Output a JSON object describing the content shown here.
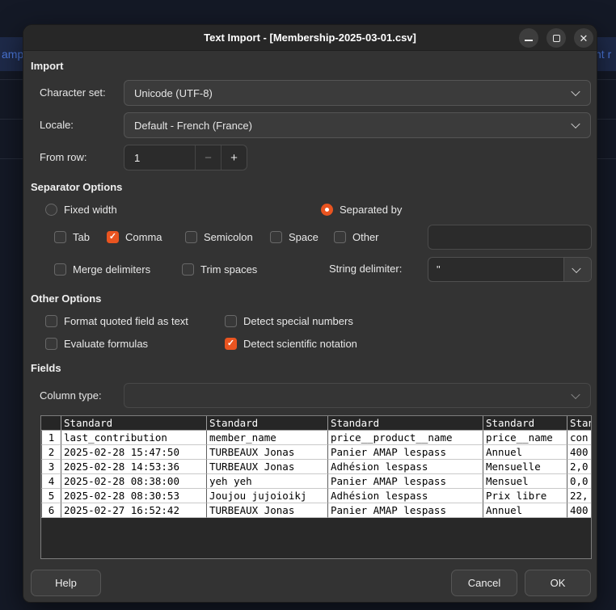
{
  "window": {
    "title": "Text Import - [Membership-2025-03-01.csv]"
  },
  "backdrop": {
    "left_fragment": "amp",
    "right_fragment": "nt r"
  },
  "import_section": {
    "heading": "Import",
    "character_set": {
      "label": "Character set:",
      "value": "Unicode (UTF-8)"
    },
    "locale": {
      "label": "Locale:",
      "value": "Default - French (France)"
    },
    "from_row": {
      "label": "From row:",
      "value": "1",
      "decrement": "−",
      "increment": "+"
    }
  },
  "separator_options": {
    "heading": "Separator Options",
    "fixed_width": {
      "label": "Fixed width",
      "checked": false
    },
    "separated_by": {
      "label": "Separated by",
      "checked": true
    },
    "tab": {
      "label": "Tab",
      "checked": false
    },
    "comma": {
      "label": "Comma",
      "checked": true
    },
    "semicolon": {
      "label": "Semicolon",
      "checked": false
    },
    "space": {
      "label": "Space",
      "checked": false
    },
    "other": {
      "label": "Other",
      "checked": false,
      "value": ""
    },
    "merge_delimiters": {
      "label": "Merge delimiters",
      "checked": false
    },
    "trim_spaces": {
      "label": "Trim spaces",
      "checked": false
    },
    "string_delimiter": {
      "label": "String delimiter:",
      "value": "\""
    }
  },
  "other_options": {
    "heading": "Other Options",
    "format_quoted": {
      "label": "Format quoted field as text",
      "checked": false
    },
    "detect_special": {
      "label": "Detect special numbers",
      "checked": false
    },
    "evaluate_formulas": {
      "label": "Evaluate formulas",
      "checked": false
    },
    "detect_scientific": {
      "label": "Detect scientific notation",
      "checked": true
    }
  },
  "fields_section": {
    "heading": "Fields",
    "column_type": {
      "label": "Column type:",
      "value": ""
    },
    "table": {
      "column_types": [
        "Standard",
        "Standard",
        "Standard",
        "Standard",
        "Standard"
      ],
      "row_numbers": [
        "1",
        "2",
        "3",
        "4",
        "5",
        "6"
      ],
      "rows": [
        [
          "last_contribution",
          "member_name",
          "price__product__name",
          "price__name",
          "con"
        ],
        [
          "2025-02-28 15:47:50",
          "TURBEAUX Jonas",
          "Panier AMAP lespass",
          "Annuel",
          "400"
        ],
        [
          "2025-02-28 14:53:36",
          "TURBEAUX Jonas",
          "Adhésion lespass",
          "Mensuelle",
          "2,0"
        ],
        [
          "2025-02-28 08:38:00",
          "yeh yeh",
          "Panier AMAP lespass",
          "Mensuel",
          "0,0"
        ],
        [
          "2025-02-28 08:30:53",
          "Joujou jujoioikj",
          "Adhésion lespass",
          "Prix libre",
          "22,"
        ],
        [
          "2025-02-27 16:52:42",
          "TURBEAUX Jonas",
          "Panier AMAP lespass",
          "Annuel",
          "400"
        ]
      ]
    }
  },
  "buttons": {
    "help": "Help",
    "cancel": "Cancel",
    "ok": "OK"
  },
  "icons": {
    "check": "✓",
    "minimize": "minus",
    "maximize": "square",
    "close": "✕"
  },
  "colors": {
    "accent": "#E95420",
    "dialog_bg": "#333333",
    "titlebar_bg": "#272727",
    "backdrop_bg": "#141926",
    "highlight_row_bg": "#1e2a49",
    "link_blue": "#4a76d8",
    "cell_bg": "#ffffff"
  }
}
